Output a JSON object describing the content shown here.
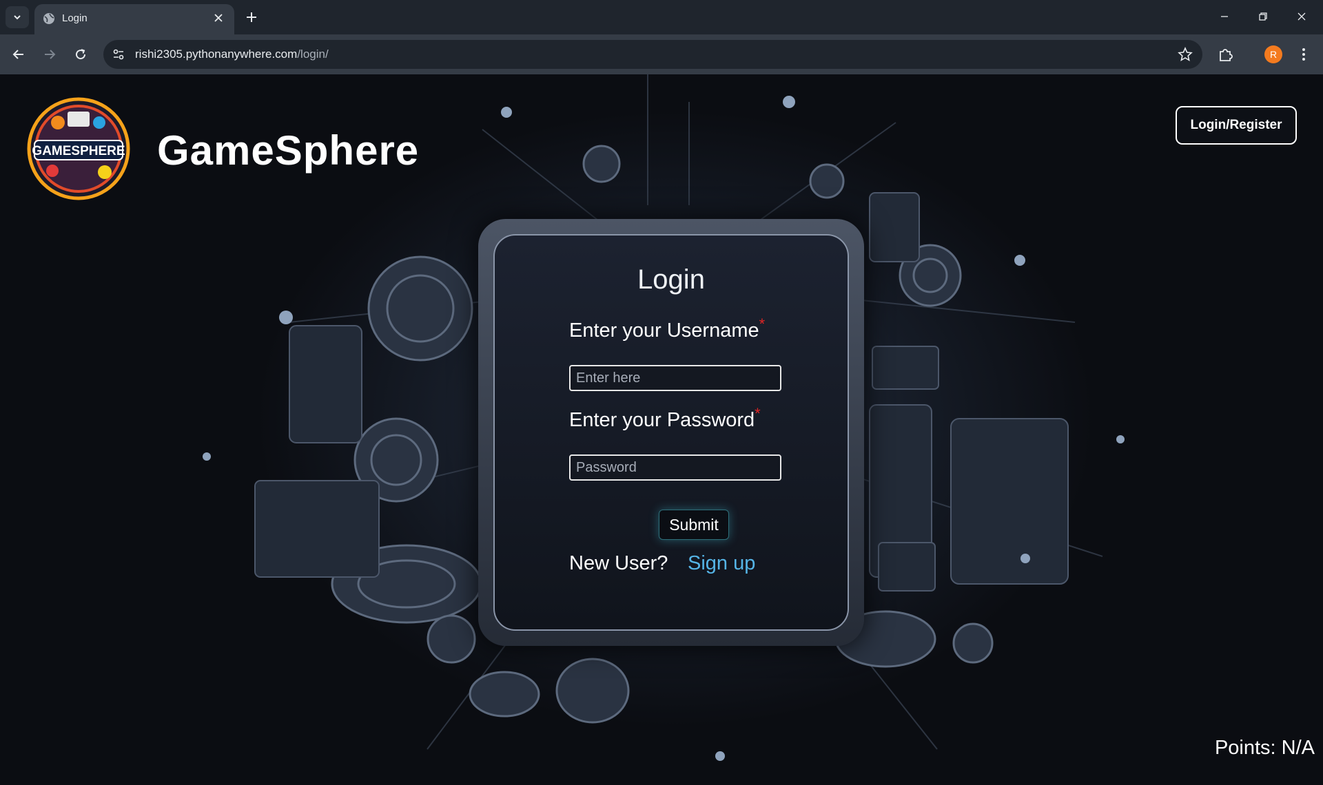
{
  "browser": {
    "tab_title": "Login",
    "url_host": "rishi2305.pythonanywhere.com",
    "url_path": "/login/",
    "avatar_letter": "R"
  },
  "header": {
    "logo_text": "GAMESPHERE",
    "site_title": "GameSphere",
    "login_register_label": "Login/Register"
  },
  "login_form": {
    "heading": "Login",
    "username_label": "Enter your Username",
    "username_placeholder": "Enter here",
    "password_label": "Enter your Password",
    "password_placeholder": "Password",
    "required_mark": "*",
    "submit_label": "Submit",
    "new_user_text": "New User?",
    "signup_label": "Sign up"
  },
  "footer": {
    "points_text": "Points: N/A"
  },
  "colors": {
    "accent_link": "#55b4e6",
    "required": "#e02525",
    "chrome_bg": "#1f252d",
    "toolbar_bg": "#353c46",
    "avatar": "#f47b1f"
  }
}
